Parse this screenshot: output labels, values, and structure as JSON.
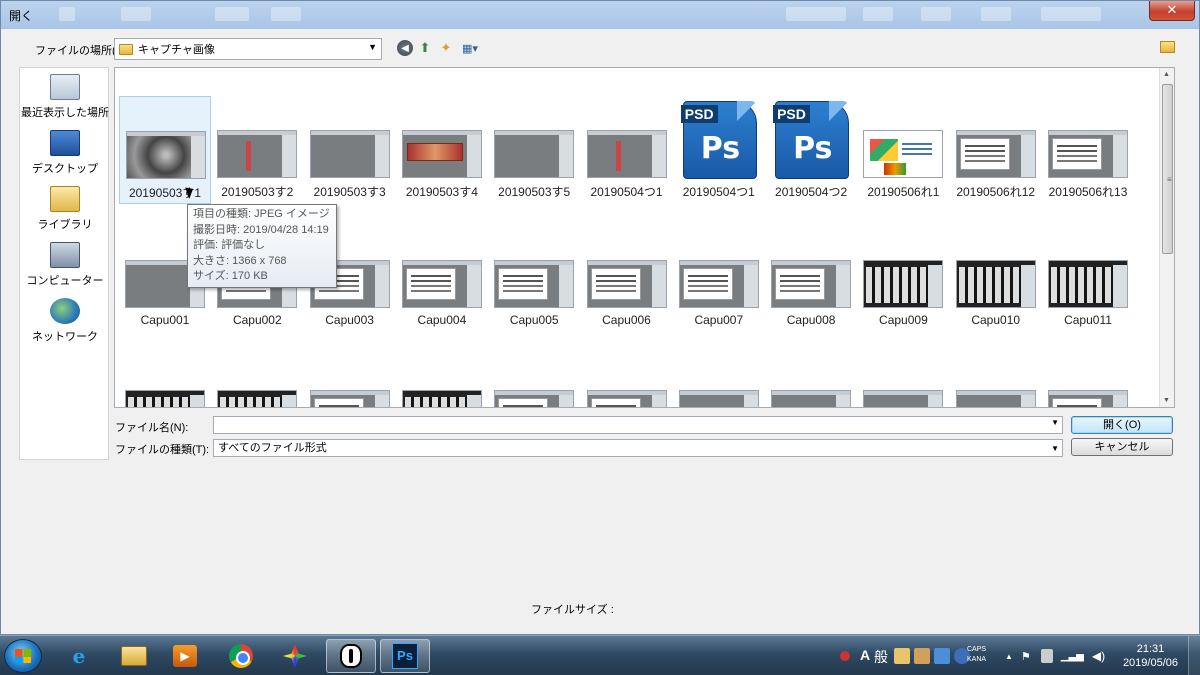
{
  "window": {
    "title": "開く"
  },
  "lookin": {
    "label": "ファイルの場所(I):",
    "value": "キャプチャ画像"
  },
  "places": [
    {
      "name": "place-recent",
      "label": "最近表示した場所",
      "icon": "recent-places-icon"
    },
    {
      "name": "place-desktop",
      "label": "デスクトップ",
      "icon": "desktop-icon"
    },
    {
      "name": "place-library",
      "label": "ライブラリ",
      "icon": "library-icon"
    },
    {
      "name": "place-computer",
      "label": "コンピューター",
      "icon": "computer-icon"
    },
    {
      "name": "place-network",
      "label": "ネットワーク",
      "icon": "network-icon"
    }
  ],
  "files": {
    "row1": [
      {
        "label": "20190503す1",
        "kind": "burst"
      },
      {
        "label": "20190503す2",
        "kind": "redbar"
      },
      {
        "label": "20190503す3",
        "kind": "gray"
      },
      {
        "label": "20190503す4",
        "kind": "banner"
      },
      {
        "label": "20190503す5",
        "kind": "gray"
      },
      {
        "label": "20190504つ1",
        "kind": "redbar"
      },
      {
        "label": "20190504つ1",
        "kind": "psd"
      },
      {
        "label": "20190504つ2",
        "kind": "psd"
      },
      {
        "label": "20190506れ1",
        "kind": "art"
      },
      {
        "label": "20190506れ12",
        "kind": "white"
      },
      {
        "label": "20190506れ13",
        "kind": "white"
      }
    ],
    "row2": [
      {
        "label": "Capu001",
        "kind": "gray"
      },
      {
        "label": "Capu002",
        "kind": "white"
      },
      {
        "label": "Capu003",
        "kind": "white"
      },
      {
        "label": "Capu004",
        "kind": "white"
      },
      {
        "label": "Capu005",
        "kind": "white"
      },
      {
        "label": "Capu006",
        "kind": "white"
      },
      {
        "label": "Capu007",
        "kind": "white"
      },
      {
        "label": "Capu008",
        "kind": "white"
      },
      {
        "label": "Capu009",
        "kind": "dark"
      },
      {
        "label": "Capu010",
        "kind": "dark"
      },
      {
        "label": "Capu011",
        "kind": "dark"
      }
    ],
    "row3": [
      {
        "label": "",
        "kind": "dark"
      },
      {
        "label": "",
        "kind": "dark"
      },
      {
        "label": "",
        "kind": "white"
      },
      {
        "label": "",
        "kind": "dark"
      },
      {
        "label": "",
        "kind": "white"
      },
      {
        "label": "",
        "kind": "white"
      },
      {
        "label": "",
        "kind": "gray"
      },
      {
        "label": "",
        "kind": "gray"
      },
      {
        "label": "",
        "kind": "gray"
      },
      {
        "label": "",
        "kind": "gray"
      },
      {
        "label": "",
        "kind": "white"
      }
    ],
    "psd_tag": "PSD",
    "psd_text": "Ps"
  },
  "tooltip": {
    "line1": "項目の種類: JPEG イメージ",
    "line2": "撮影日時: 2019/04/28 14:19",
    "line3": "評価: 評価なし",
    "line4": "大きさ: 1366 x 768",
    "line5": "サイズ: 170 KB"
  },
  "fields": {
    "filename_label": "ファイル名(N):",
    "filename_value": "",
    "filetype_label": "ファイルの種類(T):",
    "filetype_value": "すべてのファイル形式",
    "open_button": "開く(O)",
    "cancel_button": "キャンセル",
    "filesize_label": "ファイルサイズ :"
  },
  "taskbar": {
    "ime_mode": "A",
    "ime_gen": "般",
    "caps": "CAPS",
    "kana": "KANA",
    "time": "21:31",
    "date": "2019/05/06",
    "ps_label": "Ps",
    "ie_label": "e"
  }
}
